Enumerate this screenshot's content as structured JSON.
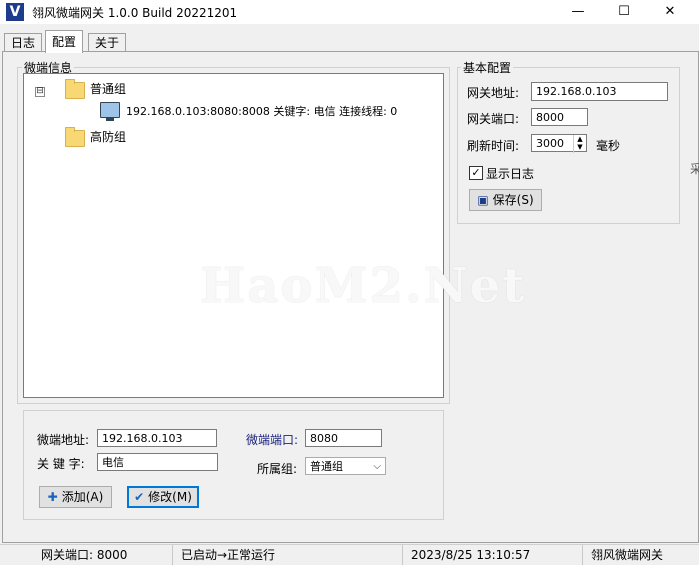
{
  "window": {
    "title": "翎风微端网关 1.0.0 Build 20221201",
    "app_icon_letter": "V",
    "minimize": "—",
    "maximize": "☐",
    "close": "✕"
  },
  "tabs": [
    {
      "label": "日志"
    },
    {
      "label": "配置"
    },
    {
      "label": "关于"
    }
  ],
  "microclient": {
    "group_title": "微端信息",
    "tree": {
      "groups": [
        {
          "name": "普通组",
          "expanded": true,
          "expander": "⊟"
        },
        {
          "name": "高防组",
          "expanded": false
        }
      ],
      "entry": {
        "text": "192.168.0.103:8080:8008 关键字: 电信 连接线程: 0"
      }
    },
    "form": {
      "addr_label": "微端地址:",
      "addr_value": "192.168.0.103",
      "port_label": "微端端口:",
      "port_value": "8080",
      "keyword_label": "关 键 字:",
      "keyword_value": "电信",
      "group_label": "所属组:",
      "group_value": "普通组",
      "add_button": "添加(A)",
      "modify_button": "修改(M)"
    }
  },
  "basic_config": {
    "group_title": "基本配置",
    "gateway_addr_label": "网关地址:",
    "gateway_addr_value": "192.168.0.103",
    "gateway_port_label": "网关端口:",
    "gateway_port_value": "8000",
    "refresh_label": "刷新时间:",
    "refresh_value": "3000",
    "refresh_unit": "毫秒",
    "show_log_label": "显示日志",
    "show_log_checked": true,
    "save_button": "保存(S)"
  },
  "watermark": "HaoM2.Net",
  "statusbar": {
    "gateway_port": "网关端口: 8000",
    "state": "已启动→正常运行",
    "datetime": "2023/8/25 13:10:57",
    "brand": "翎风微端网关"
  },
  "right_edge_glyph": "采"
}
